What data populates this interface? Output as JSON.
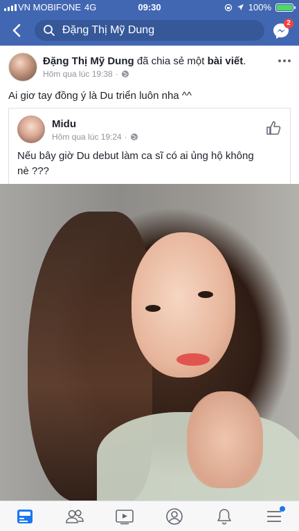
{
  "status_bar": {
    "carrier": "VN MOBIFONE",
    "network": "4G",
    "time": "09:30",
    "battery": "100%"
  },
  "header": {
    "search_value": "Đặng Thị Mỹ Dung",
    "messenger_badge": "2",
    "accent_color": "#4267b2"
  },
  "post": {
    "author": "Đặng Thị Mỹ Dung",
    "action_text": "đã chia sẻ một",
    "action_link": "bài viết",
    "time": "Hôm qua lúc 19:38",
    "text": "Ai giơ tay đồng ý là Du triển luôn nha ^^"
  },
  "shared_post": {
    "author": "Midu",
    "time": "Hôm qua lúc 19:24",
    "text": "Nếu bây giờ Du debut làm ca sĩ có ai ủng hộ không nè ???"
  },
  "tabbar": {
    "items": [
      {
        "icon": "news-feed-icon",
        "active": true
      },
      {
        "icon": "friends-icon",
        "active": false
      },
      {
        "icon": "watch-icon",
        "active": false
      },
      {
        "icon": "profile-icon",
        "active": false
      },
      {
        "icon": "notifications-icon",
        "active": false
      },
      {
        "icon": "menu-icon",
        "active": false,
        "dot": true
      }
    ]
  }
}
